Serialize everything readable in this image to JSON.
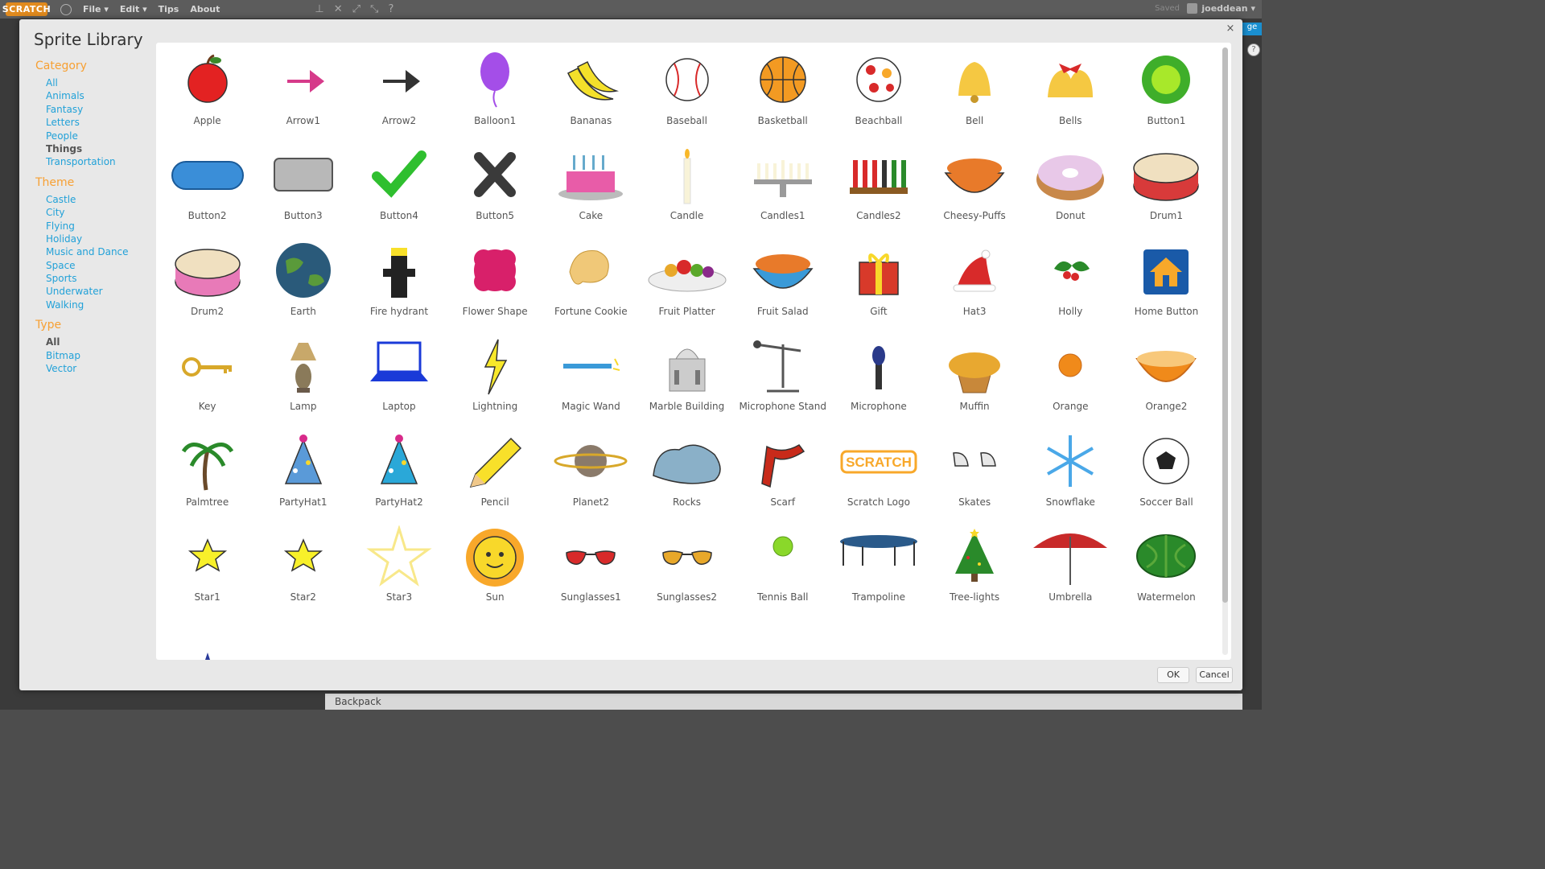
{
  "topbar": {
    "logo": "SCRATCH",
    "menus": [
      "File ▾",
      "Edit ▾",
      "Tips",
      "About"
    ],
    "saved": "Saved",
    "username": "joeddean ▾"
  },
  "background": {
    "backpack": "Backpack",
    "right_stub": "ge"
  },
  "dialog": {
    "title": "Sprite Library",
    "close": "×",
    "ok": "OK",
    "cancel": "Cancel"
  },
  "sidebar": {
    "category_title": "Category",
    "category": [
      "All",
      "Animals",
      "Fantasy",
      "Letters",
      "People",
      "Things",
      "Transportation"
    ],
    "category_active": "Things",
    "theme_title": "Theme",
    "theme": [
      "Castle",
      "City",
      "Flying",
      "Holiday",
      "Music and Dance",
      "Space",
      "Sports",
      "Underwater",
      "Walking"
    ],
    "type_title": "Type",
    "type": [
      "All",
      "Bitmap",
      "Vector"
    ],
    "type_active": "All"
  },
  "sprites": [
    {
      "label": "Apple",
      "icon": "apple-icon",
      "color": "#e32222"
    },
    {
      "label": "Arrow1",
      "icon": "arrow-icon",
      "color": "#d63a8a"
    },
    {
      "label": "Arrow2",
      "icon": "arrow-icon",
      "color": "#333333"
    },
    {
      "label": "Balloon1",
      "icon": "balloon-icon",
      "color": "#a44ee8"
    },
    {
      "label": "Bananas",
      "icon": "bananas-icon",
      "color": "#f4e02a"
    },
    {
      "label": "Baseball",
      "icon": "baseball-icon",
      "color": "#ffffff"
    },
    {
      "label": "Basketball",
      "icon": "basketball-icon",
      "color": "#f39a22"
    },
    {
      "label": "Beachball",
      "icon": "beachball-icon",
      "color": "#ffffff"
    },
    {
      "label": "Bell",
      "icon": "bell-icon",
      "color": "#f5c842"
    },
    {
      "label": "Bells",
      "icon": "bells-icon",
      "color": "#f5c842"
    },
    {
      "label": "Button1",
      "icon": "circle-button-icon",
      "color": "#3fae2a"
    },
    {
      "label": "Button2",
      "icon": "pill-button-icon",
      "color": "#3a8ed8"
    },
    {
      "label": "Button3",
      "icon": "rect-button-icon",
      "color": "#b8b8b8"
    },
    {
      "label": "Button4",
      "icon": "checkmark-icon",
      "color": "#2fbf2f"
    },
    {
      "label": "Button5",
      "icon": "x-mark-icon",
      "color": "#3a3a3a"
    },
    {
      "label": "Cake",
      "icon": "cake-icon",
      "color": "#e85ca8"
    },
    {
      "label": "Candle",
      "icon": "candle-icon",
      "color": "#f8f3d8"
    },
    {
      "label": "Candles1",
      "icon": "menorah-icon",
      "color": "#9a9a9a"
    },
    {
      "label": "Candles2",
      "icon": "kinara-icon",
      "color": "#8a5a22"
    },
    {
      "label": "Cheesy-Puffs",
      "icon": "bowl-icon",
      "color": "#e87a2a"
    },
    {
      "label": "Donut",
      "icon": "donut-icon",
      "color": "#e8c8e8"
    },
    {
      "label": "Drum1",
      "icon": "drum-icon",
      "color": "#d83a3a"
    },
    {
      "label": "Drum2",
      "icon": "drum-icon",
      "color": "#e87ab8"
    },
    {
      "label": "Earth",
      "icon": "earth-icon",
      "color": "#2a5a7a"
    },
    {
      "label": "Fire hydrant",
      "icon": "hydrant-icon",
      "color": "#222222"
    },
    {
      "label": "Flower Shape",
      "icon": "flower-shape-icon",
      "color": "#d8206a"
    },
    {
      "label": "Fortune Cookie",
      "icon": "cookie-icon",
      "color": "#f0c878"
    },
    {
      "label": "Fruit Platter",
      "icon": "fruit-platter-icon",
      "color": "#e85a2a"
    },
    {
      "label": "Fruit Salad",
      "icon": "bowl-icon",
      "color": "#3a9ad8"
    },
    {
      "label": "Gift",
      "icon": "gift-icon",
      "color": "#d83a2a"
    },
    {
      "label": "Hat3",
      "icon": "santa-hat-icon",
      "color": "#d82a2a"
    },
    {
      "label": "Holly",
      "icon": "holly-icon",
      "color": "#2a8a2a"
    },
    {
      "label": "Home Button",
      "icon": "home-icon",
      "color": "#1a5aa8"
    },
    {
      "label": "Key",
      "icon": "key-icon",
      "color": "#d8a82a"
    },
    {
      "label": "Lamp",
      "icon": "lamp-icon",
      "color": "#b89a6a"
    },
    {
      "label": "Laptop",
      "icon": "laptop-icon",
      "color": "#1a3ad8"
    },
    {
      "label": "Lightning",
      "icon": "lightning-icon",
      "color": "#f8e82a"
    },
    {
      "label": "Magic Wand",
      "icon": "wand-icon",
      "color": "#3a9ad8"
    },
    {
      "label": "Marble Building",
      "icon": "building-icon",
      "color": "#cccccc"
    },
    {
      "label": "Microphone Stand",
      "icon": "mic-stand-icon",
      "color": "#555555"
    },
    {
      "label": "Microphone",
      "icon": "microphone-icon",
      "color": "#2a3a8a"
    },
    {
      "label": "Muffin",
      "icon": "muffin-icon",
      "color": "#e8a830"
    },
    {
      "label": "Orange",
      "icon": "orange-icon",
      "color": "#f08a1a"
    },
    {
      "label": "Orange2",
      "icon": "orange-half-icon",
      "color": "#f08a1a"
    },
    {
      "label": "Palmtree",
      "icon": "palm-tree-icon",
      "color": "#2a8a2a"
    },
    {
      "label": "PartyHat1",
      "icon": "party-hat-icon",
      "color": "#5a9ad8"
    },
    {
      "label": "PartyHat2",
      "icon": "party-hat-icon",
      "color": "#2aa8d8"
    },
    {
      "label": "Pencil",
      "icon": "pencil-icon",
      "color": "#f8e02a"
    },
    {
      "label": "Planet2",
      "icon": "planet-icon",
      "color": "#8a7a6a"
    },
    {
      "label": "Rocks",
      "icon": "rocks-icon",
      "color": "#8ab0c8"
    },
    {
      "label": "Scarf",
      "icon": "scarf-icon",
      "color": "#c82a1a"
    },
    {
      "label": "Scratch Logo",
      "icon": "scratch-logo-icon",
      "color": "#f8a82a"
    },
    {
      "label": "Skates",
      "icon": "skates-icon",
      "color": "#e8e8e8"
    },
    {
      "label": "Snowflake",
      "icon": "snowflake-icon",
      "color": "#4aa8e8"
    },
    {
      "label": "Soccer Ball",
      "icon": "soccer-ball-icon",
      "color": "#ffffff"
    },
    {
      "label": "Star1",
      "icon": "star-icon",
      "color": "#f8f02a"
    },
    {
      "label": "Star2",
      "icon": "star-icon",
      "color": "#f8f02a"
    },
    {
      "label": "Star3",
      "icon": "star-outline-icon",
      "color": "#f8e88a"
    },
    {
      "label": "Sun",
      "icon": "sun-icon",
      "color": "#f8d82a"
    },
    {
      "label": "Sunglasses1",
      "icon": "sunglasses-icon",
      "color": "#d82a2a"
    },
    {
      "label": "Sunglasses2",
      "icon": "sunglasses-icon",
      "color": "#e8a82a"
    },
    {
      "label": "Tennis Ball",
      "icon": "tennis-ball-icon",
      "color": "#8ad82a"
    },
    {
      "label": "Trampoline",
      "icon": "trampoline-icon",
      "color": "#2a5a8a"
    },
    {
      "label": "Tree-lights",
      "icon": "christmas-tree-icon",
      "color": "#2a8a2a"
    },
    {
      "label": "Umbrella",
      "icon": "umbrella-icon",
      "color": "#c82a2a"
    },
    {
      "label": "Watermelon",
      "icon": "watermelon-icon",
      "color": "#2a8a2a"
    },
    {
      "label": "",
      "icon": "wizard-hat-icon",
      "color": "#2a3a9a"
    }
  ]
}
